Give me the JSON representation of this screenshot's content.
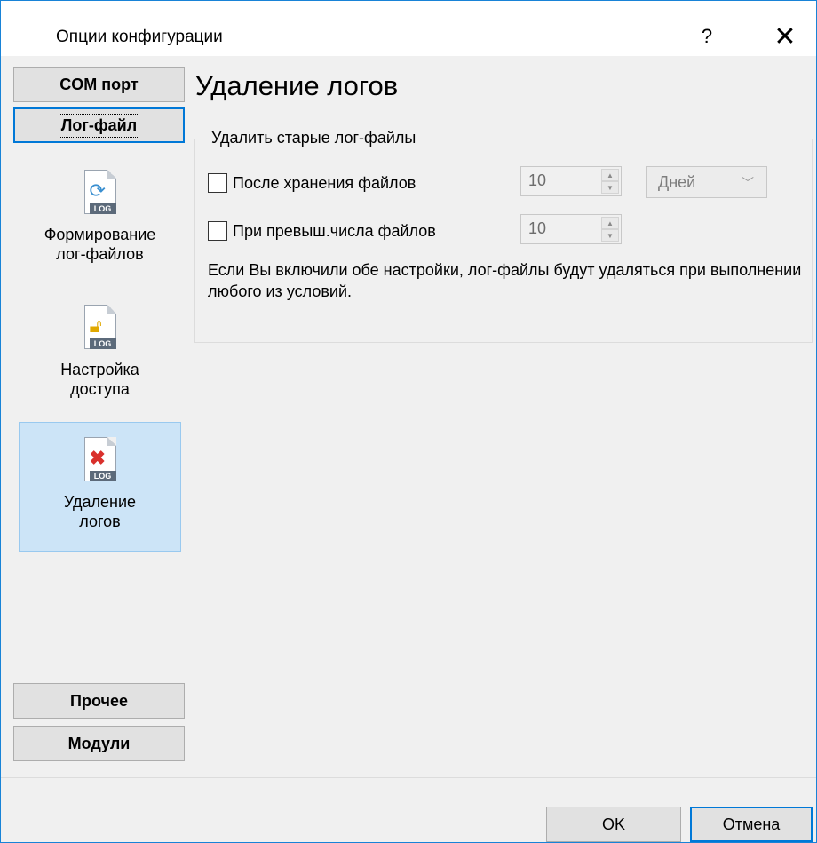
{
  "window": {
    "title": "Опции конфигурации",
    "help_label": "?",
    "close_label": "✕"
  },
  "sidebar": {
    "com_port": "COM порт",
    "log_file": "Лог-файл",
    "items": [
      {
        "label_line1": "Формирование",
        "label_line2": "лог-файлов",
        "icon": "log-refresh-icon"
      },
      {
        "label_line1": "Настройка",
        "label_line2": "доступа",
        "icon": "log-lock-icon"
      },
      {
        "label_line1": "Удаление",
        "label_line2": "логов",
        "icon": "log-delete-icon"
      }
    ],
    "other": "Прочее",
    "modules": "Модули"
  },
  "main": {
    "heading": "Удаление логов",
    "group_title": "Удалить старые лог-файлы",
    "opt1_label": "После хранения файлов",
    "opt1_value": "10",
    "opt1_unit": "Дней",
    "opt2_label": "При превыш.числа файлов",
    "opt2_value": "10",
    "note": "Если Вы включили обе настройки, лог-файлы будут удаляться при выполнении любого из условий."
  },
  "footer": {
    "ok": "OK",
    "cancel": "Отмена"
  },
  "colors": {
    "accent": "#0078d7",
    "selected_bg": "#cce4f7",
    "window_bg": "#f0f0f0"
  }
}
